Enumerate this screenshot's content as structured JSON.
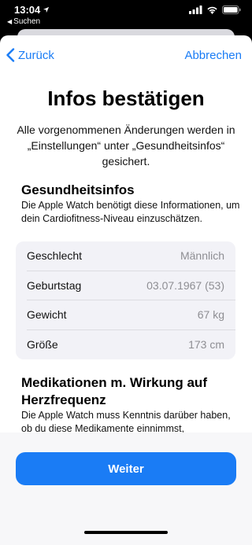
{
  "status": {
    "time": "13:04",
    "back_app": "Suchen"
  },
  "nav": {
    "back_label": "Zurück",
    "cancel_label": "Abbrechen"
  },
  "title": "Infos bestätigen",
  "subtitle": "Alle vorgenommenen Änderungen werden in „Einstellungen“ unter „Gesundheitsinfos“ gesichert.",
  "health": {
    "heading": "Gesundheitsinfos",
    "description": "Die Apple Watch benötigt diese Informationen, um dein Cardiofitness-Niveau einzuschätzen.",
    "rows": [
      {
        "label": "Geschlecht",
        "value": "Männlich"
      },
      {
        "label": "Geburtstag",
        "value": "03.07.1967 (53)"
      },
      {
        "label": "Gewicht",
        "value": "67 kg"
      },
      {
        "label": "Größe",
        "value": "173 cm"
      }
    ]
  },
  "medication": {
    "heading": "Medikationen m. Wirkung auf Herzfrequenz",
    "description": "Die Apple Watch muss Kenntnis darüber haben, ob du diese Medikamente einnimmst,"
  },
  "continue_label": "Weiter",
  "colors": {
    "accent": "#1a7cf5",
    "secondary_text": "#8e8e93",
    "group_background": "#f2f2f7"
  }
}
